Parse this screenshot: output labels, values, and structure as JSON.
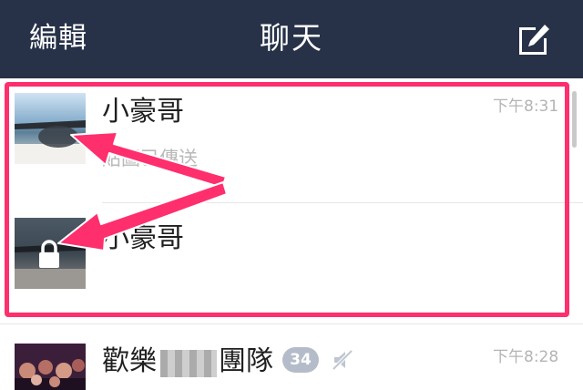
{
  "header": {
    "edit_label": "編輯",
    "title": "聊天",
    "compose_icon": "compose-icon"
  },
  "chats": [
    {
      "name": "小豪哥",
      "time": "下午8:31",
      "preview": "貼圖已傳送",
      "avatar": "sunglasses-beach-photo"
    },
    {
      "name": "小豪哥",
      "time": "",
      "preview": "",
      "avatar": "sunglasses-beach-photo",
      "locked": true,
      "lock_icon": "lock-icon"
    },
    {
      "name_prefix": "歡樂",
      "name_suffix": "團隊",
      "time": "下午8:28",
      "unread_count": "34",
      "muted": true,
      "mute_icon": "mute-icon",
      "avatar": "group-party-photo"
    }
  ],
  "colors": {
    "header_bg": "#273248",
    "highlight": "#ff2e6d",
    "arrow": "#ff2e6d",
    "badge_bg": "#b5bcc9"
  }
}
